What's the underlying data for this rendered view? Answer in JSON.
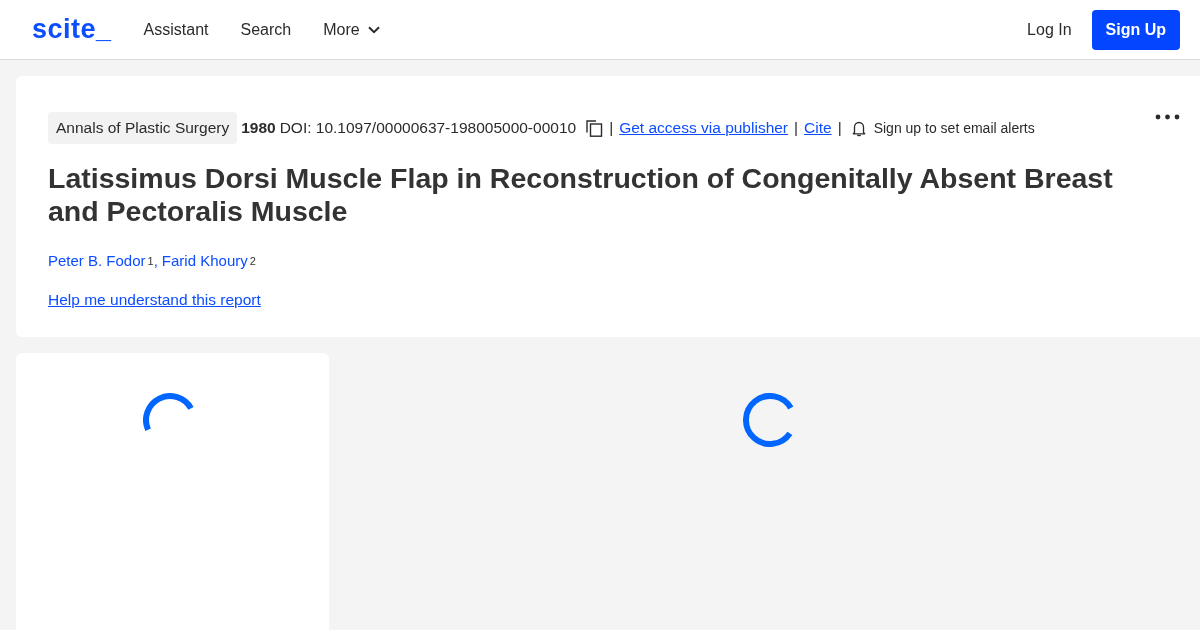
{
  "header": {
    "logo": "scite_",
    "nav": [
      {
        "label": "Assistant",
        "kind": "link"
      },
      {
        "label": "Search",
        "kind": "link"
      },
      {
        "label": "More",
        "kind": "menu"
      }
    ],
    "login": "Log In",
    "signup": "Sign Up"
  },
  "article": {
    "meta": [
      {
        "kind": "tag",
        "text": "Annals of Plastic Surgery"
      },
      {
        "kind": "year",
        "text": "1980"
      },
      {
        "kind": "doi",
        "text": "DOI: 10.1097/00000637-198005000-00010"
      },
      {
        "kind": "separator",
        "text": "|"
      },
      {
        "kind": "link",
        "text": "Get access via publisher"
      },
      {
        "kind": "separator",
        "text": "|"
      },
      {
        "kind": "link",
        "text": "Cite"
      },
      {
        "kind": "separator",
        "text": "|"
      },
      {
        "kind": "alert",
        "text": "Sign up to set email alerts"
      }
    ],
    "title": "Latissimus Dorsi Muscle Flap in Reconstruction of Congenitally Absent Breast and Pectoralis Muscle",
    "authors": [
      {
        "name": "Peter B. Fodor",
        "affiliation": "1"
      },
      {
        "name": "Farid Khoury",
        "affiliation": "2"
      }
    ],
    "author_separator": ",",
    "help_link": "Help me understand this report"
  },
  "panels": [
    {
      "kind": "card",
      "loading": true
    },
    {
      "kind": "plain",
      "loading": true
    }
  ]
}
